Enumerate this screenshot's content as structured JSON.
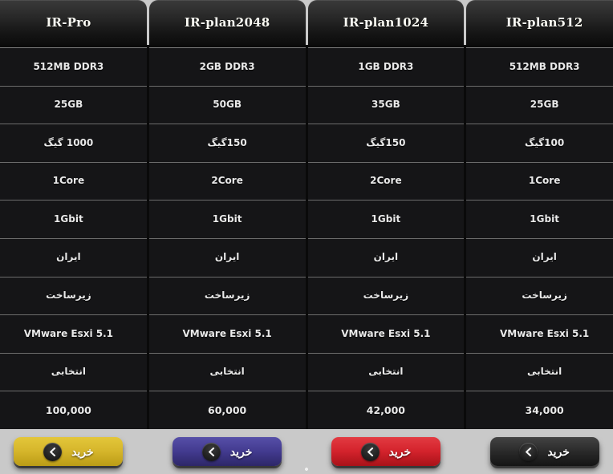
{
  "theme": {
    "cell_background": "#151517",
    "divider": "#6c6c6c",
    "text": "#e9e9e9",
    "header_text": "#fbfbf4"
  },
  "plans": [
    {
      "name": "IR-Pro",
      "button": {
        "label": "خرید",
        "color": "#d6b62b",
        "variant": "gold",
        "icon": "chevron-left-icon"
      },
      "features": [
        "512MB DDR3",
        "25GB",
        "1000 گیگ",
        "1Core",
        "1Gbit",
        "ایران",
        "زیرساخت",
        "VMware Esxi 5.1",
        "انتخابی",
        "100,000"
      ]
    },
    {
      "name": "IR-plan2048",
      "button": {
        "label": "خرید",
        "color": "#433b90",
        "variant": "blue",
        "icon": "chevron-left-icon"
      },
      "features": [
        "2GB DDR3",
        "50GB",
        "150گیگ",
        "2Core",
        "1Gbit",
        "ایران",
        "زیرساخت",
        "VMware Esxi 5.1",
        "انتخابی",
        "60,000"
      ]
    },
    {
      "name": "IR-plan1024",
      "button": {
        "label": "خرید",
        "color": "#d4232c",
        "variant": "red",
        "icon": "chevron-left-icon"
      },
      "features": [
        "1GB DDR3",
        "35GB",
        "150گیگ",
        "2Core",
        "1Gbit",
        "ایران",
        "زیرساخت",
        "VMware Esxi 5.1",
        "انتخابی",
        "42,000"
      ]
    },
    {
      "name": "IR-plan512",
      "button": {
        "label": "خرید",
        "color": "#2b2b2b",
        "variant": "black",
        "icon": "chevron-left-icon"
      },
      "features": [
        "512MB DDR3",
        "25GB",
        "100گیگ",
        "1Core",
        "1Gbit",
        "ایران",
        "زیرساخت",
        "VMware Esxi 5.1",
        "انتخابی",
        "34,000"
      ]
    }
  ]
}
